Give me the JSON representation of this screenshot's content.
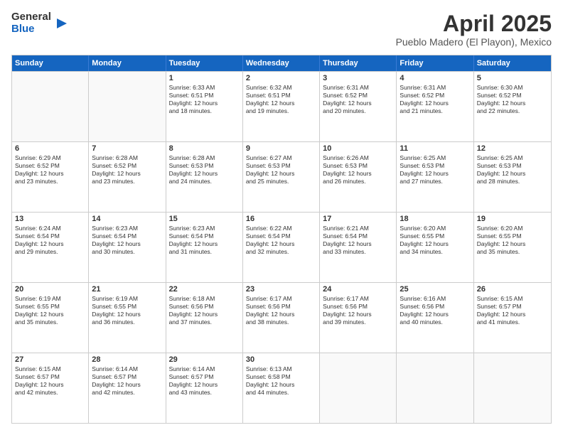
{
  "logo": {
    "line1": "General",
    "line2": "Blue"
  },
  "title": "April 2025",
  "subtitle": "Pueblo Madero (El Playon), Mexico",
  "header_days": [
    "Sunday",
    "Monday",
    "Tuesday",
    "Wednesday",
    "Thursday",
    "Friday",
    "Saturday"
  ],
  "weeks": [
    [
      {
        "day": "",
        "lines": []
      },
      {
        "day": "",
        "lines": []
      },
      {
        "day": "1",
        "lines": [
          "Sunrise: 6:33 AM",
          "Sunset: 6:51 PM",
          "Daylight: 12 hours",
          "and 18 minutes."
        ]
      },
      {
        "day": "2",
        "lines": [
          "Sunrise: 6:32 AM",
          "Sunset: 6:51 PM",
          "Daylight: 12 hours",
          "and 19 minutes."
        ]
      },
      {
        "day": "3",
        "lines": [
          "Sunrise: 6:31 AM",
          "Sunset: 6:52 PM",
          "Daylight: 12 hours",
          "and 20 minutes."
        ]
      },
      {
        "day": "4",
        "lines": [
          "Sunrise: 6:31 AM",
          "Sunset: 6:52 PM",
          "Daylight: 12 hours",
          "and 21 minutes."
        ]
      },
      {
        "day": "5",
        "lines": [
          "Sunrise: 6:30 AM",
          "Sunset: 6:52 PM",
          "Daylight: 12 hours",
          "and 22 minutes."
        ]
      }
    ],
    [
      {
        "day": "6",
        "lines": [
          "Sunrise: 6:29 AM",
          "Sunset: 6:52 PM",
          "Daylight: 12 hours",
          "and 23 minutes."
        ]
      },
      {
        "day": "7",
        "lines": [
          "Sunrise: 6:28 AM",
          "Sunset: 6:52 PM",
          "Daylight: 12 hours",
          "and 23 minutes."
        ]
      },
      {
        "day": "8",
        "lines": [
          "Sunrise: 6:28 AM",
          "Sunset: 6:53 PM",
          "Daylight: 12 hours",
          "and 24 minutes."
        ]
      },
      {
        "day": "9",
        "lines": [
          "Sunrise: 6:27 AM",
          "Sunset: 6:53 PM",
          "Daylight: 12 hours",
          "and 25 minutes."
        ]
      },
      {
        "day": "10",
        "lines": [
          "Sunrise: 6:26 AM",
          "Sunset: 6:53 PM",
          "Daylight: 12 hours",
          "and 26 minutes."
        ]
      },
      {
        "day": "11",
        "lines": [
          "Sunrise: 6:25 AM",
          "Sunset: 6:53 PM",
          "Daylight: 12 hours",
          "and 27 minutes."
        ]
      },
      {
        "day": "12",
        "lines": [
          "Sunrise: 6:25 AM",
          "Sunset: 6:53 PM",
          "Daylight: 12 hours",
          "and 28 minutes."
        ]
      }
    ],
    [
      {
        "day": "13",
        "lines": [
          "Sunrise: 6:24 AM",
          "Sunset: 6:54 PM",
          "Daylight: 12 hours",
          "and 29 minutes."
        ]
      },
      {
        "day": "14",
        "lines": [
          "Sunrise: 6:23 AM",
          "Sunset: 6:54 PM",
          "Daylight: 12 hours",
          "and 30 minutes."
        ]
      },
      {
        "day": "15",
        "lines": [
          "Sunrise: 6:23 AM",
          "Sunset: 6:54 PM",
          "Daylight: 12 hours",
          "and 31 minutes."
        ]
      },
      {
        "day": "16",
        "lines": [
          "Sunrise: 6:22 AM",
          "Sunset: 6:54 PM",
          "Daylight: 12 hours",
          "and 32 minutes."
        ]
      },
      {
        "day": "17",
        "lines": [
          "Sunrise: 6:21 AM",
          "Sunset: 6:54 PM",
          "Daylight: 12 hours",
          "and 33 minutes."
        ]
      },
      {
        "day": "18",
        "lines": [
          "Sunrise: 6:20 AM",
          "Sunset: 6:55 PM",
          "Daylight: 12 hours",
          "and 34 minutes."
        ]
      },
      {
        "day": "19",
        "lines": [
          "Sunrise: 6:20 AM",
          "Sunset: 6:55 PM",
          "Daylight: 12 hours",
          "and 35 minutes."
        ]
      }
    ],
    [
      {
        "day": "20",
        "lines": [
          "Sunrise: 6:19 AM",
          "Sunset: 6:55 PM",
          "Daylight: 12 hours",
          "and 35 minutes."
        ]
      },
      {
        "day": "21",
        "lines": [
          "Sunrise: 6:19 AM",
          "Sunset: 6:55 PM",
          "Daylight: 12 hours",
          "and 36 minutes."
        ]
      },
      {
        "day": "22",
        "lines": [
          "Sunrise: 6:18 AM",
          "Sunset: 6:56 PM",
          "Daylight: 12 hours",
          "and 37 minutes."
        ]
      },
      {
        "day": "23",
        "lines": [
          "Sunrise: 6:17 AM",
          "Sunset: 6:56 PM",
          "Daylight: 12 hours",
          "and 38 minutes."
        ]
      },
      {
        "day": "24",
        "lines": [
          "Sunrise: 6:17 AM",
          "Sunset: 6:56 PM",
          "Daylight: 12 hours",
          "and 39 minutes."
        ]
      },
      {
        "day": "25",
        "lines": [
          "Sunrise: 6:16 AM",
          "Sunset: 6:56 PM",
          "Daylight: 12 hours",
          "and 40 minutes."
        ]
      },
      {
        "day": "26",
        "lines": [
          "Sunrise: 6:15 AM",
          "Sunset: 6:57 PM",
          "Daylight: 12 hours",
          "and 41 minutes."
        ]
      }
    ],
    [
      {
        "day": "27",
        "lines": [
          "Sunrise: 6:15 AM",
          "Sunset: 6:57 PM",
          "Daylight: 12 hours",
          "and 42 minutes."
        ]
      },
      {
        "day": "28",
        "lines": [
          "Sunrise: 6:14 AM",
          "Sunset: 6:57 PM",
          "Daylight: 12 hours",
          "and 42 minutes."
        ]
      },
      {
        "day": "29",
        "lines": [
          "Sunrise: 6:14 AM",
          "Sunset: 6:57 PM",
          "Daylight: 12 hours",
          "and 43 minutes."
        ]
      },
      {
        "day": "30",
        "lines": [
          "Sunrise: 6:13 AM",
          "Sunset: 6:58 PM",
          "Daylight: 12 hours",
          "and 44 minutes."
        ]
      },
      {
        "day": "",
        "lines": []
      },
      {
        "day": "",
        "lines": []
      },
      {
        "day": "",
        "lines": []
      }
    ]
  ]
}
